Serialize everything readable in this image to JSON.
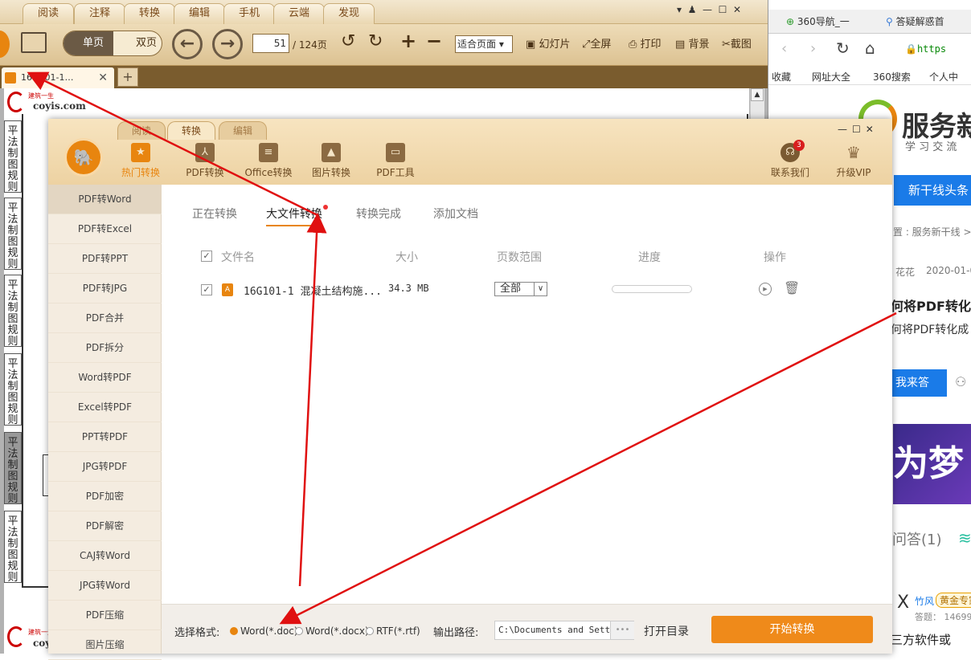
{
  "reader": {
    "menu_tabs": [
      "阅读",
      "注释",
      "转换",
      "编辑",
      "手机",
      "云端",
      "发现"
    ],
    "view_single": "单页",
    "view_double": "双页",
    "page_current": "51",
    "page_total": "/ 124页",
    "fit_select": "适合页面",
    "tools": [
      "幻灯片",
      "全屏",
      "打印",
      "背景",
      "截图"
    ],
    "doc_tab": "16G101-1…",
    "add_tab": "+",
    "logo_cn": "建筑一生",
    "logo_site": "coyis.com",
    "side_tabs": [
      "平法制图规则",
      "平法制图规则",
      "平法制图规则",
      "平法制图规则",
      "平法制图规则",
      "平法制图规则"
    ]
  },
  "browser": {
    "tabs": [
      "360导航_一",
      "答疑解惑首"
    ],
    "url": "https",
    "bookmarks": [
      "收藏",
      "网址大全",
      "360搜索",
      "个人中"
    ],
    "brand": "服务新",
    "brand_sub": "学 习 交 流",
    "headline_btn": "新干线头条",
    "crumb": "置 : 服务新干线 >",
    "author": "花花",
    "date": "2020-01-0",
    "title": "何将PDF转化成",
    "snippet": "何将PDF转化成",
    "answer_btn": "我来答",
    "banner_text": "为梦",
    "answers": "问答(1)",
    "user": "竹风",
    "badge": "黄金专家",
    "stats": "答题： 14699",
    "footer_text": "三方软件或"
  },
  "dialog": {
    "tabs": [
      "阅读",
      "转换",
      "编辑"
    ],
    "nav": [
      {
        "label": "热门转换",
        "icon": "star"
      },
      {
        "label": "PDF转换",
        "icon": "pdf"
      },
      {
        "label": "Office转换",
        "icon": "doc"
      },
      {
        "label": "图片转换",
        "icon": "image"
      },
      {
        "label": "PDF工具",
        "icon": "toolbox"
      }
    ],
    "contact": "联系我们",
    "contact_badge": "3",
    "vip": "升级VIP",
    "sidebar": [
      "PDF转Word",
      "PDF转Excel",
      "PDF转PPT",
      "PDF转JPG",
      "PDF合并",
      "PDF拆分",
      "Word转PDF",
      "Excel转PDF",
      "PPT转PDF",
      "JPG转PDF",
      "PDF加密",
      "PDF解密",
      "CAJ转Word",
      "JPG转Word",
      "PDF压缩",
      "图片压缩"
    ],
    "content_tabs": [
      "正在转换",
      "大文件转换",
      "转换完成",
      "添加文档"
    ],
    "columns": [
      "文件名",
      "大小",
      "页数范围",
      "进度",
      "操作"
    ],
    "file": {
      "name": "16G101-1 混凝土结构施...",
      "size": "34.3 MB",
      "range": "全部",
      "progress": 0
    },
    "format_label": "选择格式:",
    "formats": [
      "Word(*.doc)",
      "Word(*.docx)",
      "RTF(*.rtf)"
    ],
    "output_label": "输出路径:",
    "output_path": "C:\\Documents and Setti",
    "browse": "•••",
    "open_dir": "打开目录",
    "start": "开始转换"
  }
}
